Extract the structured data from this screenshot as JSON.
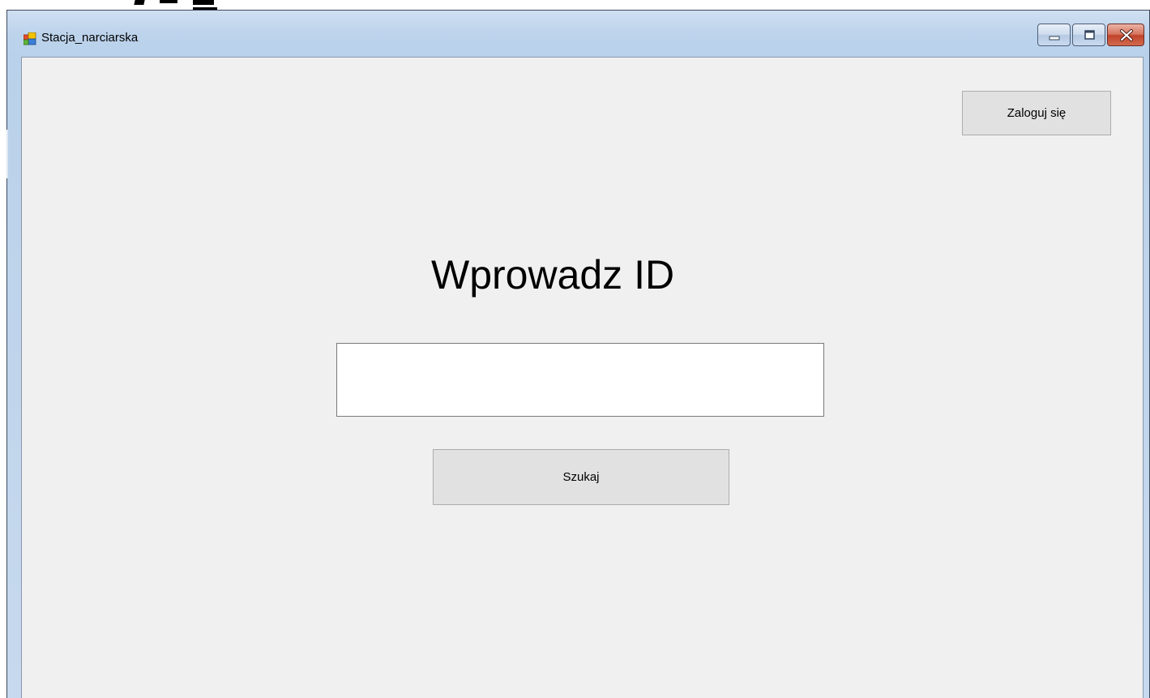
{
  "window": {
    "title": "Stacja_narciarska",
    "icon": "windows-forms-app-icon",
    "controls": {
      "minimize_icon": "minimize-icon",
      "maximize_icon": "maximize-icon",
      "close_icon": "close-icon"
    }
  },
  "form": {
    "login_button_label": "Zaloguj się",
    "heading": "Wprowadz ID",
    "id_input_value": "",
    "search_button_label": "Szukaj"
  },
  "colors": {
    "client_background": "#f0f0f0",
    "button_background": "#e1e1e1",
    "close_button": "#c7442b"
  }
}
